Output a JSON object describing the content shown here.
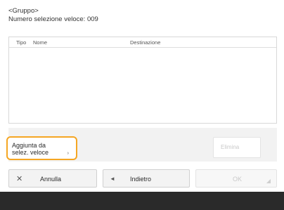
{
  "header": {
    "group": "<Gruppo>",
    "speed_dial": "Numero selezione veloce: 009"
  },
  "list": {
    "columns": [
      "Tipo",
      "Nome",
      "Destinazione"
    ],
    "rows": []
  },
  "actions": {
    "add_label": "Aggiunta da\nselez. veloce",
    "delete_label": "Elimina"
  },
  "footer": {
    "cancel_label": "Annulla",
    "back_label": "Indietro",
    "ok_label": "OK"
  }
}
